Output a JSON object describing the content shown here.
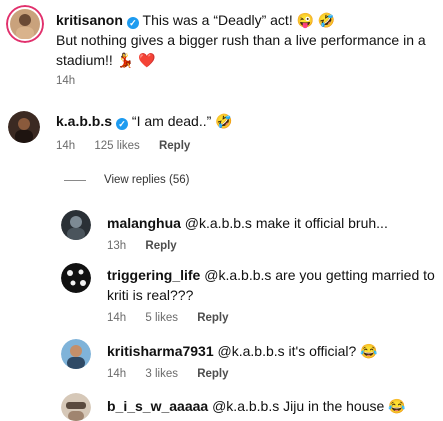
{
  "comments": [
    {
      "username": "kritisanon",
      "verified": true,
      "text_line1": "This was a “Deadly” act! 😜 🤣",
      "text_line2": "But nothing gives a bigger rush than a live performance in a",
      "text_line3": "stadium!! 💃 ❤️",
      "time": "14h"
    },
    {
      "username": "k.a.b.b.s",
      "verified": true,
      "text": "“I am dead..” 🤣",
      "time": "14h",
      "likes": "125 likes",
      "reply_label": "Reply"
    }
  ],
  "view_replies": "View replies (56)",
  "replies": [
    {
      "username": "malanghua",
      "text": "@k.a.b.b.s make it official bruh...",
      "time": "13h",
      "reply_label": "Reply"
    },
    {
      "username": "triggering_life",
      "text_line1": "@k.a.b.b.s are you getting married to",
      "text_line2": "kriti is real???",
      "time": "14h",
      "likes": "5 likes",
      "reply_label": "Reply"
    },
    {
      "username": "kritisharma7931",
      "text": "@k.a.b.b.s it's official? 😂",
      "time": "14h",
      "likes": "3 likes",
      "reply_label": "Reply"
    },
    {
      "username": "b_i_s_w_aaaaa",
      "text": "@k.a.b.b.s Jiju in the house 😂"
    }
  ],
  "colors": {
    "verified": "#1d9bf0",
    "meta_text": "#6b6b6b",
    "story_ring": "#e1306c"
  }
}
